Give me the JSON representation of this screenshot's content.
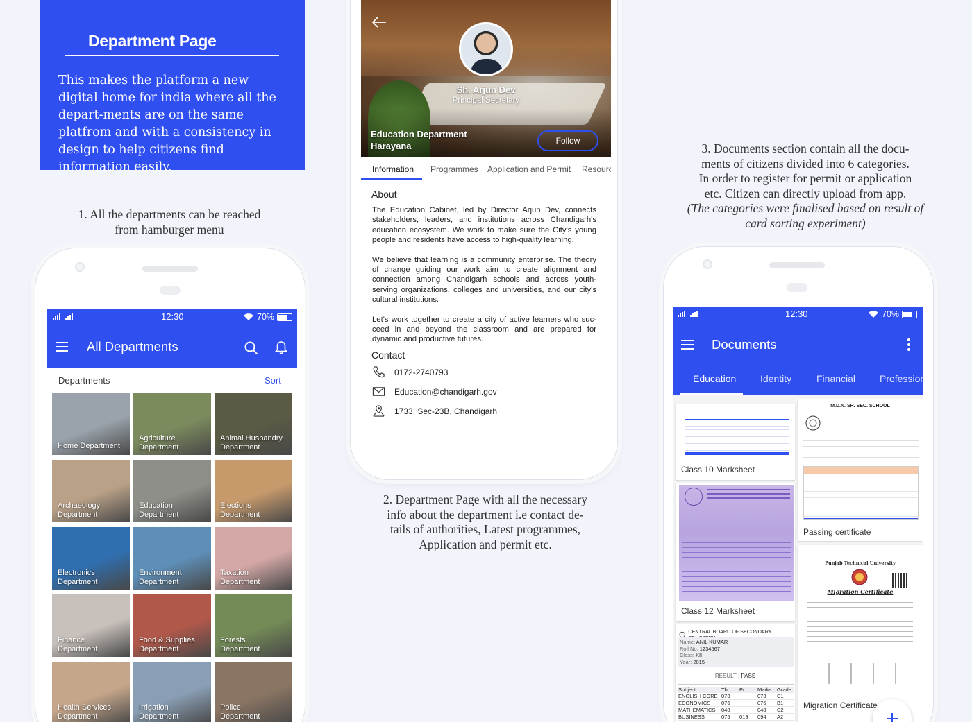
{
  "intro": {
    "title": "Department Page",
    "body": "This makes the platform a new digital home for india where all the depart-ments are on the same platfrom and with a consistency in design to help citizens find information easily."
  },
  "captions": {
    "c1_line1": "1. All the departments can be reached",
    "c1_line2": "from hamburger menu",
    "c2_line1": "2. Department Page with all the necessary",
    "c2_line2": "info about the department i.e contact de-",
    "c2_line3": "tails of authorities, Latest programmes,",
    "c2_line4": "Application and permit etc.",
    "c3_line1": "3. Documents section contain all the docu-",
    "c3_line2": "ments of citizens divided into 6 categories.",
    "c3_line3": "In order to  register for permit or application",
    "c3_line4": "etc. Citizen can directly upload from app.",
    "c3_line5": "(The categories were finalised based on result of",
    "c3_line6": "card sorting experiment)"
  },
  "status": {
    "time": "12:30",
    "battery": "70%"
  },
  "departments_screen": {
    "title": "All Departments",
    "section_label": "Departments",
    "sort_label": "Sort",
    "tiles": [
      {
        "l1": "Home Department",
        "l2": ""
      },
      {
        "l1": "Agriculture",
        "l2": "Department"
      },
      {
        "l1": "Animal Husbandry",
        "l2": "Department"
      },
      {
        "l1": "Archaeology",
        "l2": "Department"
      },
      {
        "l1": "Education",
        "l2": "Department"
      },
      {
        "l1": "Elections",
        "l2": "Department"
      },
      {
        "l1": "Electronics",
        "l2": "Department"
      },
      {
        "l1": "Environment",
        "l2": "Department"
      },
      {
        "l1": "Taxation",
        "l2": "Department"
      },
      {
        "l1": "Finance",
        "l2": "Department"
      },
      {
        "l1": "Food & Supplies",
        "l2": "Department"
      },
      {
        "l1": "Forests",
        "l2": "Department"
      },
      {
        "l1": "Health Services",
        "l2": "Department"
      },
      {
        "l1": "Irrigation",
        "l2": "Department"
      },
      {
        "l1": "Police",
        "l2": "Department"
      }
    ],
    "tile_colors": [
      "#9aa3ab",
      "#7c8b5e",
      "#5b5a45",
      "#b9a187",
      "#8d8f88",
      "#c79a6c",
      "#2f6fb0",
      "#5e8fb8",
      "#d3a7a5",
      "#c8c0bb",
      "#b2584a",
      "#748b57",
      "#c6a68a",
      "#8a9fb5",
      "#8a7563"
    ]
  },
  "department_page": {
    "name": "Sh. Arjun Dev",
    "role": "Principal Secretary",
    "dept_line1": "Education Department",
    "dept_line2": "Harayana",
    "follow": "Follow",
    "tabs": [
      "Information",
      "Programmes",
      "Application and Permit",
      "Resourc"
    ],
    "about_heading": "About",
    "about_p1": "The Education Cabinet, led by Director Arjun Dev, connects stakeholders, leaders, and institutions across Chandigarh's education ecosystem. We work to make sure the City's young people and residents have access to high-quality learning.",
    "about_p2": "We believe that learning is a community enterprise. The theory of change guiding our work aim to create alignment and connection among Chandigarh schools and across youth-serving organizations, colleges and universities, and our city's cultural institutions.",
    "about_p3": "Let's work together to create a city of active learners who suc-ceed in and beyond the classroom and are prepared for dynamic and productive futures.",
    "contact_heading": "Contact",
    "phone": "0172-2740793",
    "email": "Education@chandigarh.gov",
    "address": "1733, Sec-23B,  Chandigarh"
  },
  "documents_screen": {
    "title": "Documents",
    "tabs": [
      "Education",
      "Identity",
      "Financial",
      "Profession"
    ],
    "cards": {
      "class10": "Class 10 Marksheet",
      "passing": "Passing certificate",
      "class12": "Class 12 Marksheet",
      "migration": "Migration Certificate"
    },
    "school_header": "M.D.N. SR. SEC. SCHOOL",
    "cbse": {
      "header": "CENTRAL BOARD OF SECONDARY EDUCATION",
      "name_label": "Name:",
      "name": "ANIL KUMAR",
      "roll_label": "Roll No:",
      "roll": "1234567",
      "class_label": "Class:",
      "class": "XII",
      "year_label": "Year:",
      "year": "2015",
      "result_label": "RESULT :",
      "result": "PASS",
      "col_subject": "Subject",
      "col_th": "Th.",
      "col_pr": "Pr.",
      "col_marks": "Marks",
      "col_grade": "Grade",
      "rows": [
        {
          "s": "ENGLISH CORE",
          "th": "073",
          "pr": "",
          "m": "073",
          "g": "C1"
        },
        {
          "s": "ECONOMICS",
          "th": "076",
          "pr": "",
          "m": "076",
          "g": "B1"
        },
        {
          "s": "MATHEMATICS",
          "th": "048",
          "pr": "",
          "m": "048",
          "g": "C2"
        },
        {
          "s": "BUSINESS",
          "th": "075",
          "pr": "019",
          "m": "094",
          "g": "A2"
        }
      ]
    },
    "migration_univ": "Punjab Technical University",
    "migration_title": "Migration Certificate"
  }
}
